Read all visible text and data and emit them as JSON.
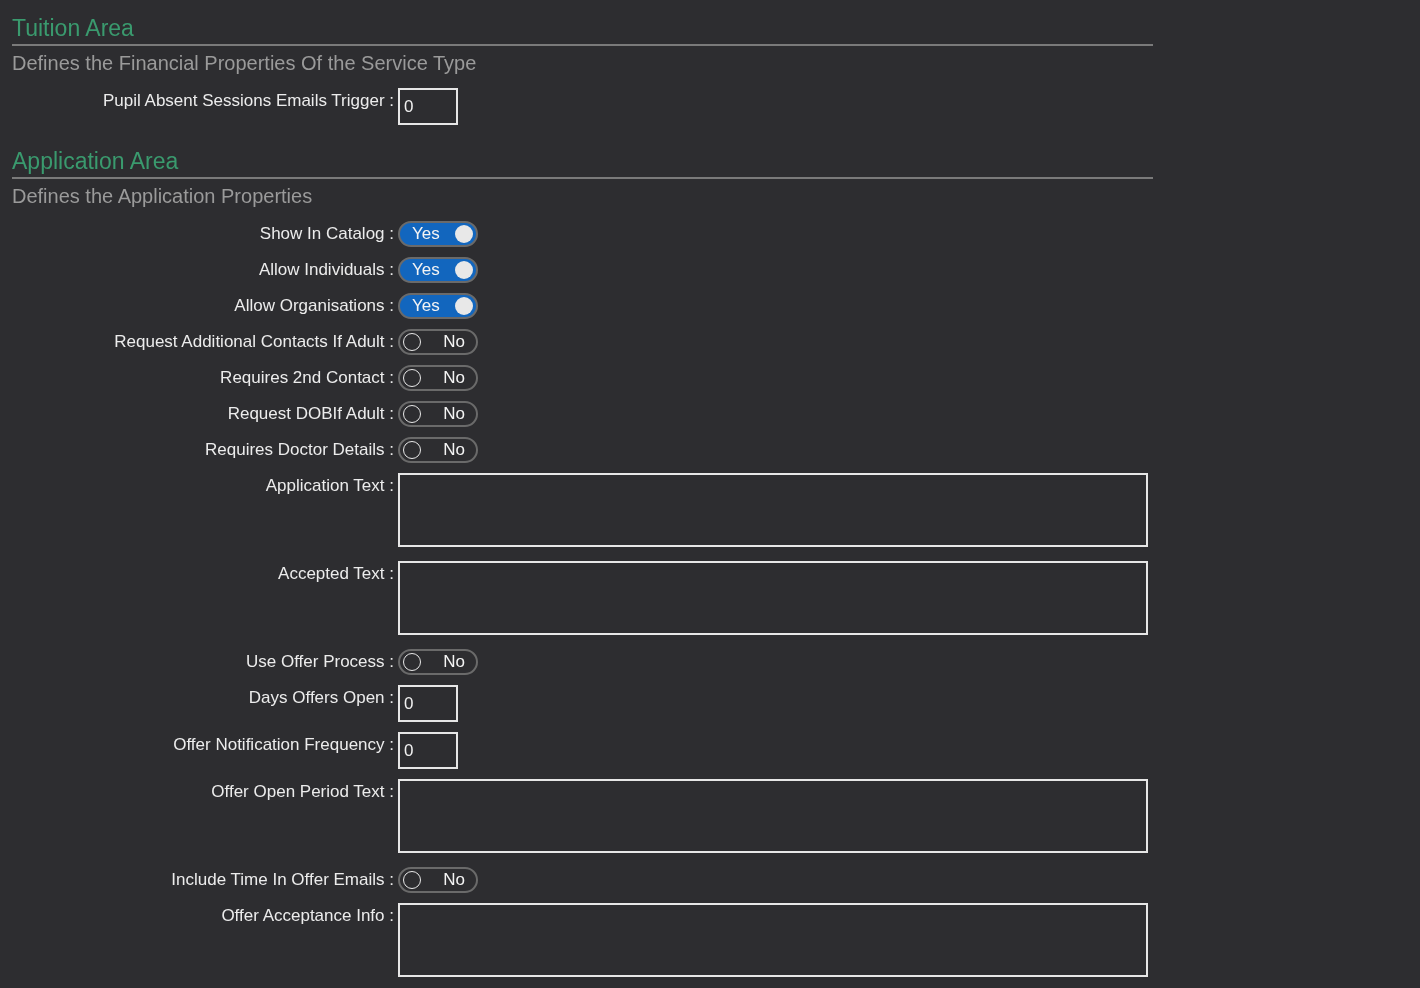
{
  "sections": [
    {
      "title": "Tuition Area",
      "subtitle": "Defines the Financial Properties Of the Service Type",
      "fields": [
        {
          "kind": "number",
          "label": "Pupil Absent Sessions Emails Trigger :",
          "value": "0"
        }
      ]
    },
    {
      "title": "Application Area",
      "subtitle": "Defines the Application Properties",
      "fields": [
        {
          "kind": "toggle",
          "label": "Show In Catalog :",
          "on": true,
          "text": "Yes"
        },
        {
          "kind": "toggle",
          "label": "Allow Individuals :",
          "on": true,
          "text": "Yes"
        },
        {
          "kind": "toggle",
          "label": "Allow Organisations :",
          "on": true,
          "text": "Yes"
        },
        {
          "kind": "toggle",
          "label": "Request Additional Contacts If Adult :",
          "on": false,
          "text": "No"
        },
        {
          "kind": "toggle",
          "label": "Requires 2nd Contact :",
          "on": false,
          "text": "No"
        },
        {
          "kind": "toggle",
          "label": "Request DOBIf Adult :",
          "on": false,
          "text": "No"
        },
        {
          "kind": "toggle",
          "label": "Requires Doctor Details :",
          "on": false,
          "text": "No"
        },
        {
          "kind": "textarea",
          "label": "Application Text :"
        },
        {
          "kind": "textarea",
          "label": "Accepted Text :"
        },
        {
          "kind": "toggle",
          "label": "Use Offer Process :",
          "on": false,
          "text": "No"
        },
        {
          "kind": "number",
          "label": "Days Offers Open :",
          "value": "0"
        },
        {
          "kind": "number",
          "label": "Offer Notification Frequency :",
          "value": "0"
        },
        {
          "kind": "textarea",
          "label": "Offer Open Period Text :"
        },
        {
          "kind": "toggle",
          "label": "Include Time In Offer Emails :",
          "on": false,
          "text": "No"
        },
        {
          "kind": "textarea",
          "label": "Offer Acceptance Info :"
        }
      ]
    }
  ]
}
